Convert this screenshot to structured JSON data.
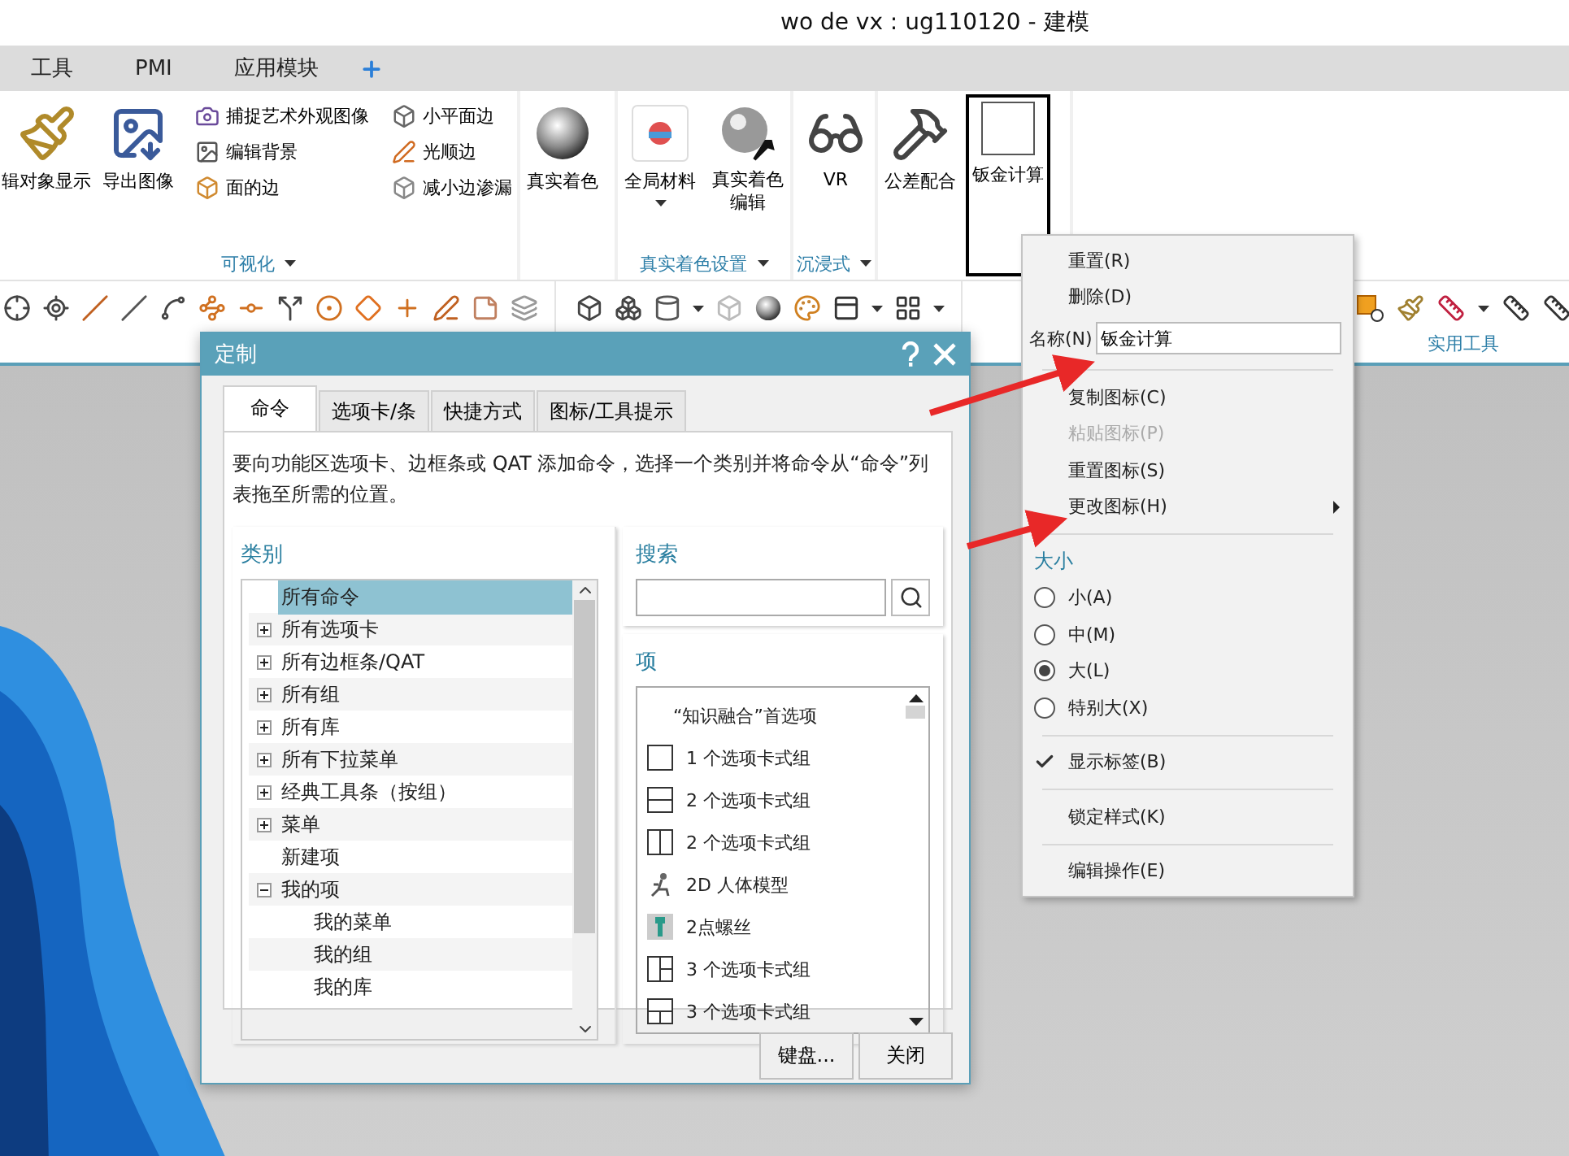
{
  "window": {
    "title": "wo de vx : ug110120 - 建模"
  },
  "menu_tabs": [
    {
      "label": "工具"
    },
    {
      "label": "PMI"
    },
    {
      "label": "应用模块"
    }
  ],
  "ribbon": {
    "groups": [
      {
        "label": "可视化",
        "buttons": [
          {
            "label": "辑对象显示",
            "kind": "large",
            "selected": false
          },
          {
            "label": "导出图像",
            "kind": "large",
            "selected": false
          },
          {
            "label": "捕捉艺术外观图像",
            "kind": "small",
            "selected": false
          },
          {
            "label": "编辑背景",
            "kind": "small",
            "selected": false
          },
          {
            "label": "面的边",
            "kind": "small",
            "selected": false
          },
          {
            "label": "小平面边",
            "kind": "small",
            "selected": false
          },
          {
            "label": "光顺边",
            "kind": "small",
            "selected": false
          },
          {
            "label": "减小边渗漏",
            "kind": "small",
            "selected": false
          }
        ]
      },
      {
        "buttons": [
          {
            "label": "真实着色",
            "kind": "large",
            "selected": false
          }
        ]
      },
      {
        "label": "真实着色设置",
        "buttons": [
          {
            "label": "全局材料",
            "kind": "large",
            "selected": false,
            "dropdown": true
          },
          {
            "label": "真实着色编辑",
            "kind": "large",
            "selected": false
          }
        ]
      },
      {
        "label": "沉浸式",
        "buttons": [
          {
            "label": "VR",
            "kind": "large",
            "selected": false
          }
        ]
      },
      {
        "buttons": [
          {
            "label": "公差配合",
            "kind": "large",
            "selected": false
          },
          {
            "label": "钣金计算",
            "kind": "large",
            "selected": true
          }
        ]
      }
    ]
  },
  "toolbar": {
    "group_label": "实用工具"
  },
  "dialog": {
    "title": "定制",
    "tabs": [
      {
        "label": "命令",
        "selected": true
      },
      {
        "label": "选项卡/条",
        "selected": false
      },
      {
        "label": "快捷方式",
        "selected": false
      },
      {
        "label": "图标/工具提示",
        "selected": false
      }
    ],
    "description": "要向功能区选项卡、边框条或 QAT 添加命令，选择一个类别并将命令从“命令”列表拖至所需的位置。",
    "category": {
      "heading": "类别",
      "tree": [
        {
          "label": "所有命令",
          "selected": true
        },
        {
          "label": "所有选项卡",
          "selected": false,
          "expanded": false
        },
        {
          "label": "所有边框条/QAT",
          "selected": false,
          "expanded": false
        },
        {
          "label": "所有组",
          "selected": false,
          "expanded": false
        },
        {
          "label": "所有库",
          "selected": false,
          "expanded": false
        },
        {
          "label": "所有下拉菜单",
          "selected": false,
          "expanded": false
        },
        {
          "label": "经典工具条（按组）",
          "selected": false,
          "expanded": false
        },
        {
          "label": "菜单",
          "selected": false,
          "expanded": false
        },
        {
          "label": "新建项",
          "selected": false
        },
        {
          "label": "我的项",
          "selected": false,
          "expanded": true,
          "children": [
            {
              "label": "我的菜单",
              "selected": false
            },
            {
              "label": "我的组",
              "selected": false
            },
            {
              "label": "我的库",
              "selected": false
            }
          ]
        }
      ]
    },
    "search": {
      "heading": "搜索"
    },
    "items": {
      "heading": "项",
      "list": [
        {
          "label": "“知识融合”首选项"
        },
        {
          "label": "1 个选项卡式组"
        },
        {
          "label": "2 个选项卡式组"
        },
        {
          "label": "2 个选项卡式组"
        },
        {
          "label": "2D 人体模型"
        },
        {
          "label": "2点螺丝"
        },
        {
          "label": "3 个选项卡式组"
        },
        {
          "label": "3 个选项卡式组"
        }
      ]
    },
    "buttons": [
      "键盘...",
      "关闭"
    ]
  },
  "context_menu": {
    "entries": [
      {
        "kind": "item",
        "label": "重置(R)",
        "disabled": false,
        "submenu": false
      },
      {
        "kind": "item",
        "label": "删除(D)",
        "disabled": false,
        "submenu": false
      },
      {
        "kind": "field",
        "label": "名称(N)",
        "value": "钣金计算"
      },
      {
        "kind": "separator"
      },
      {
        "kind": "item",
        "label": "复制图标(C)",
        "disabled": false,
        "submenu": false
      },
      {
        "kind": "item",
        "label": "粘贴图标(P)",
        "disabled": true,
        "submenu": false
      },
      {
        "kind": "item",
        "label": "重置图标(S)",
        "disabled": false,
        "submenu": false
      },
      {
        "kind": "item",
        "label": "更改图标(H)",
        "disabled": false,
        "submenu": true
      },
      {
        "kind": "separator"
      },
      {
        "kind": "heading",
        "label": "大小"
      },
      {
        "kind": "radio",
        "label": "小(A)",
        "selected": false
      },
      {
        "kind": "radio",
        "label": "中(M)",
        "selected": false
      },
      {
        "kind": "radio",
        "label": "大(L)",
        "selected": true
      },
      {
        "kind": "radio",
        "label": "特别大(X)",
        "selected": false
      },
      {
        "kind": "separator"
      },
      {
        "kind": "check",
        "label": "显示标签(B)",
        "checked": true
      },
      {
        "kind": "separator"
      },
      {
        "kind": "item",
        "label": "锁定样式(K)",
        "disabled": false,
        "submenu": false
      },
      {
        "kind": "separator"
      },
      {
        "kind": "item",
        "label": "编辑操作(E)",
        "disabled": false,
        "submenu": false
      }
    ]
  }
}
